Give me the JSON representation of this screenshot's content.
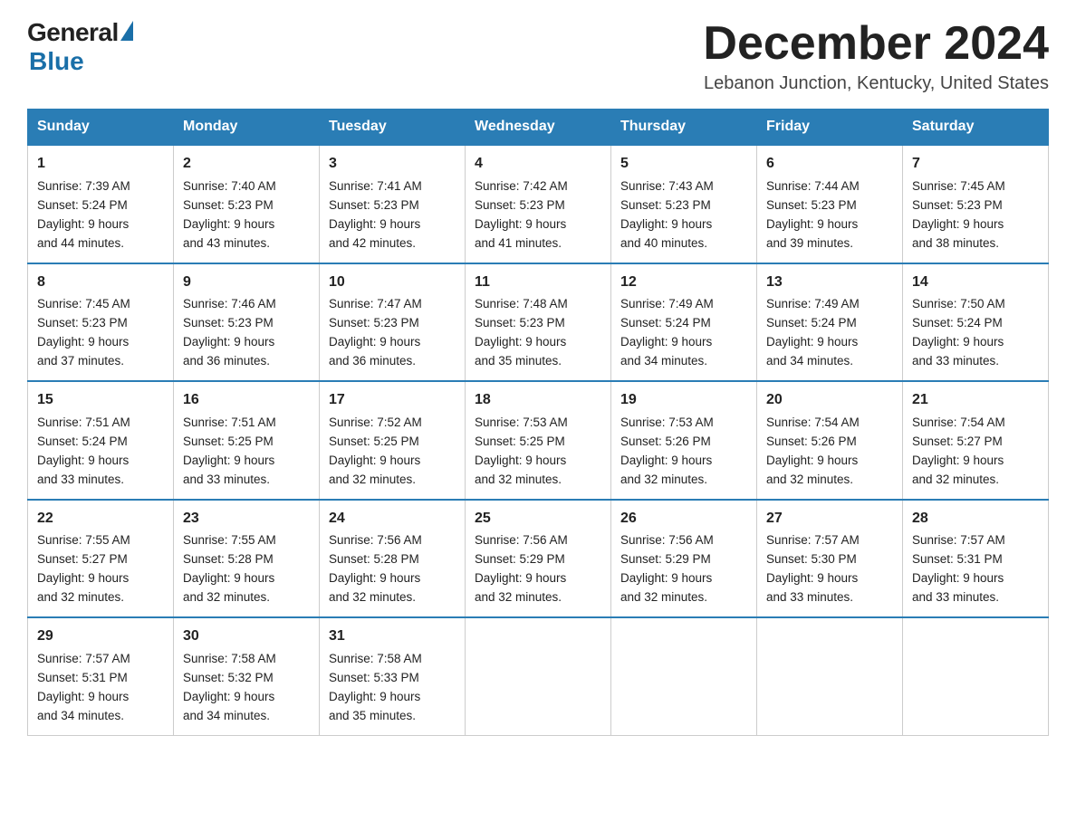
{
  "logo": {
    "general": "General",
    "blue": "Blue"
  },
  "title": "December 2024",
  "location": "Lebanon Junction, Kentucky, United States",
  "headers": [
    "Sunday",
    "Monday",
    "Tuesday",
    "Wednesday",
    "Thursday",
    "Friday",
    "Saturday"
  ],
  "weeks": [
    [
      {
        "day": "1",
        "sunrise": "7:39 AM",
        "sunset": "5:24 PM",
        "daylight": "9 hours and 44 minutes."
      },
      {
        "day": "2",
        "sunrise": "7:40 AM",
        "sunset": "5:23 PM",
        "daylight": "9 hours and 43 minutes."
      },
      {
        "day": "3",
        "sunrise": "7:41 AM",
        "sunset": "5:23 PM",
        "daylight": "9 hours and 42 minutes."
      },
      {
        "day": "4",
        "sunrise": "7:42 AM",
        "sunset": "5:23 PM",
        "daylight": "9 hours and 41 minutes."
      },
      {
        "day": "5",
        "sunrise": "7:43 AM",
        "sunset": "5:23 PM",
        "daylight": "9 hours and 40 minutes."
      },
      {
        "day": "6",
        "sunrise": "7:44 AM",
        "sunset": "5:23 PM",
        "daylight": "9 hours and 39 minutes."
      },
      {
        "day": "7",
        "sunrise": "7:45 AM",
        "sunset": "5:23 PM",
        "daylight": "9 hours and 38 minutes."
      }
    ],
    [
      {
        "day": "8",
        "sunrise": "7:45 AM",
        "sunset": "5:23 PM",
        "daylight": "9 hours and 37 minutes."
      },
      {
        "day": "9",
        "sunrise": "7:46 AM",
        "sunset": "5:23 PM",
        "daylight": "9 hours and 36 minutes."
      },
      {
        "day": "10",
        "sunrise": "7:47 AM",
        "sunset": "5:23 PM",
        "daylight": "9 hours and 36 minutes."
      },
      {
        "day": "11",
        "sunrise": "7:48 AM",
        "sunset": "5:23 PM",
        "daylight": "9 hours and 35 minutes."
      },
      {
        "day": "12",
        "sunrise": "7:49 AM",
        "sunset": "5:24 PM",
        "daylight": "9 hours and 34 minutes."
      },
      {
        "day": "13",
        "sunrise": "7:49 AM",
        "sunset": "5:24 PM",
        "daylight": "9 hours and 34 minutes."
      },
      {
        "day": "14",
        "sunrise": "7:50 AM",
        "sunset": "5:24 PM",
        "daylight": "9 hours and 33 minutes."
      }
    ],
    [
      {
        "day": "15",
        "sunrise": "7:51 AM",
        "sunset": "5:24 PM",
        "daylight": "9 hours and 33 minutes."
      },
      {
        "day": "16",
        "sunrise": "7:51 AM",
        "sunset": "5:25 PM",
        "daylight": "9 hours and 33 minutes."
      },
      {
        "day": "17",
        "sunrise": "7:52 AM",
        "sunset": "5:25 PM",
        "daylight": "9 hours and 32 minutes."
      },
      {
        "day": "18",
        "sunrise": "7:53 AM",
        "sunset": "5:25 PM",
        "daylight": "9 hours and 32 minutes."
      },
      {
        "day": "19",
        "sunrise": "7:53 AM",
        "sunset": "5:26 PM",
        "daylight": "9 hours and 32 minutes."
      },
      {
        "day": "20",
        "sunrise": "7:54 AM",
        "sunset": "5:26 PM",
        "daylight": "9 hours and 32 minutes."
      },
      {
        "day": "21",
        "sunrise": "7:54 AM",
        "sunset": "5:27 PM",
        "daylight": "9 hours and 32 minutes."
      }
    ],
    [
      {
        "day": "22",
        "sunrise": "7:55 AM",
        "sunset": "5:27 PM",
        "daylight": "9 hours and 32 minutes."
      },
      {
        "day": "23",
        "sunrise": "7:55 AM",
        "sunset": "5:28 PM",
        "daylight": "9 hours and 32 minutes."
      },
      {
        "day": "24",
        "sunrise": "7:56 AM",
        "sunset": "5:28 PM",
        "daylight": "9 hours and 32 minutes."
      },
      {
        "day": "25",
        "sunrise": "7:56 AM",
        "sunset": "5:29 PM",
        "daylight": "9 hours and 32 minutes."
      },
      {
        "day": "26",
        "sunrise": "7:56 AM",
        "sunset": "5:29 PM",
        "daylight": "9 hours and 32 minutes."
      },
      {
        "day": "27",
        "sunrise": "7:57 AM",
        "sunset": "5:30 PM",
        "daylight": "9 hours and 33 minutes."
      },
      {
        "day": "28",
        "sunrise": "7:57 AM",
        "sunset": "5:31 PM",
        "daylight": "9 hours and 33 minutes."
      }
    ],
    [
      {
        "day": "29",
        "sunrise": "7:57 AM",
        "sunset": "5:31 PM",
        "daylight": "9 hours and 34 minutes."
      },
      {
        "day": "30",
        "sunrise": "7:58 AM",
        "sunset": "5:32 PM",
        "daylight": "9 hours and 34 minutes."
      },
      {
        "day": "31",
        "sunrise": "7:58 AM",
        "sunset": "5:33 PM",
        "daylight": "9 hours and 35 minutes."
      },
      null,
      null,
      null,
      null
    ]
  ]
}
